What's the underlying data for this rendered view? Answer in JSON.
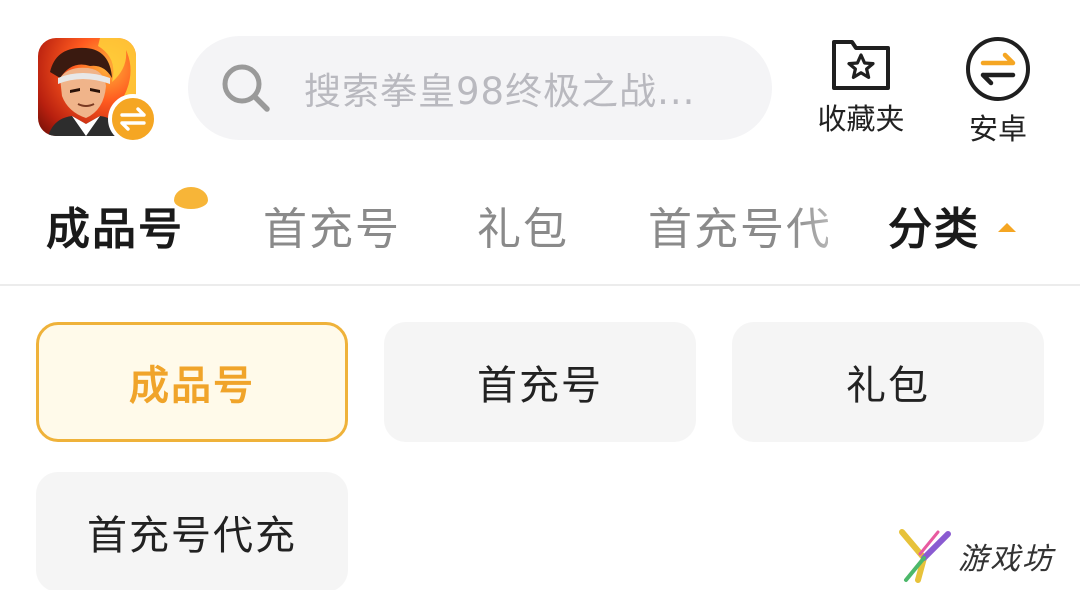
{
  "header": {
    "game_avatar": {
      "icon": "game-avatar-image",
      "badge_icon": "switch-arrows-icon",
      "badge_color": "#f5a623"
    },
    "search": {
      "icon": "search-icon",
      "placeholder": "搜索拳皇98终极之战..."
    },
    "favorites": {
      "icon": "star-folder-icon",
      "label": "收藏夹"
    },
    "platform": {
      "icon": "switch-arrows-icon",
      "label": "安卓"
    }
  },
  "tabs": {
    "items": [
      {
        "label": "成品号",
        "active": true
      },
      {
        "label": "首充号",
        "active": false
      },
      {
        "label": "礼包",
        "active": false
      },
      {
        "label": "首充号代充",
        "active": false
      }
    ],
    "category_toggle": {
      "label": "分类",
      "icon": "caret-up-icon"
    },
    "accent_color": "#f7b538"
  },
  "categories": [
    {
      "label": "成品号",
      "selected": true
    },
    {
      "label": "首充号",
      "selected": false
    },
    {
      "label": "礼包",
      "selected": false
    },
    {
      "label": "首充号代充",
      "selected": false
    }
  ],
  "watermark": {
    "text": "游戏坊",
    "icon": "watermark-logo"
  },
  "colors": {
    "accent": "#f5a623",
    "selected_text": "#f0a42a",
    "selected_bg": "#fffaea",
    "chip_bg": "#f5f5f5",
    "search_bg": "#f4f4f6"
  }
}
